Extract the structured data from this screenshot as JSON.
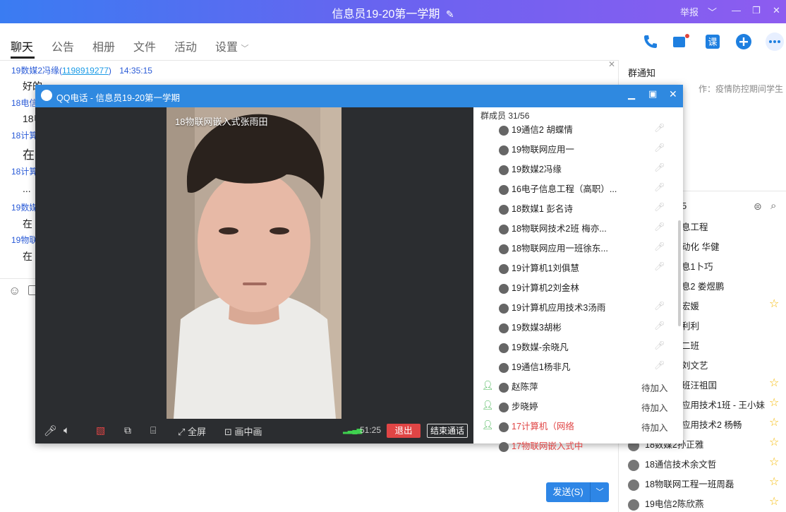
{
  "window": {
    "title": "信息员19-20第一学期",
    "report_label": "举报"
  },
  "tabs": [
    "聊天",
    "公告",
    "相册",
    "文件",
    "活动",
    "设置"
  ],
  "chat": {
    "header1": {
      "user": "19数媒2冯缘(",
      "qq": "1198919277",
      "suffix": ")",
      "time": "14:35:15"
    },
    "body1": "好的",
    "header2": "18电信",
    "body2": "18电",
    "header3": "18计算",
    "body3": "在",
    "header4": "18计算",
    "body4": "...",
    "header5": "19数媒",
    "body5": "在",
    "header6": "19物联",
    "body6": "在"
  },
  "right_panel": {
    "notice_title": "群通知",
    "notice_text": "作：疫情防控期间学生 2...",
    "member_count_partial": "5",
    "members": [
      {
        "name": "息工程",
        "star": false
      },
      {
        "name": "动化  华健",
        "star": false
      },
      {
        "name": "息1卜巧",
        "star": false
      },
      {
        "name": "息2  娄煜鹏",
        "star": false
      },
      {
        "name": "宏媛",
        "star": true
      },
      {
        "name": "利利",
        "star": false
      },
      {
        "name": "二班",
        "star": false
      },
      {
        "name": "刘文艺",
        "star": false
      },
      {
        "name": "班汪祖囯",
        "star": true
      },
      {
        "name": "应用技术1班 - 王小妹",
        "star": true
      },
      {
        "name": "应用技术2  杨畅",
        "star": true
      },
      {
        "name": "18数媒2孙正雅",
        "star": true
      },
      {
        "name": "18通信技术余文哲",
        "star": true
      },
      {
        "name": "18物联网工程一班周磊",
        "star": true
      },
      {
        "name": "19电信2陈欣燕",
        "star": true
      }
    ]
  },
  "call": {
    "title": "QQ电话  -  信息员19-20第一学期",
    "video_caption": "18物联网嵌入式张雨田",
    "members_label": "群成员 31/56",
    "members": [
      {
        "name": "19通信2 胡蝶情",
        "status": "muted"
      },
      {
        "name": "19物联网应用一",
        "status": "muted"
      },
      {
        "name": "19数媒2冯缘",
        "status": "muted"
      },
      {
        "name": "16电子信息工程（高职）...",
        "status": "muted"
      },
      {
        "name": "18数媒1 彭名诗",
        "status": "muted"
      },
      {
        "name": "18物联网技术2班  梅亦...",
        "status": "muted"
      },
      {
        "name": "18物联网应用一班徐东...",
        "status": "muted"
      },
      {
        "name": "19计算机1刘俱慧",
        "status": "muted"
      },
      {
        "name": "19计算机2刘金林",
        "status": "none"
      },
      {
        "name": "19计算机应用技术3汤雨",
        "status": "muted"
      },
      {
        "name": "19数媒3胡彬",
        "status": "muted"
      },
      {
        "name": "19数媒-余晓凡",
        "status": "muted"
      },
      {
        "name": "19通信1杨非凡",
        "status": "muted"
      },
      {
        "name": "赵陈萍",
        "status": "waiting"
      },
      {
        "name": "步晓婷",
        "status": "waiting"
      },
      {
        "name": "17计算机（网络",
        "status": "waiting",
        "red": true
      },
      {
        "name": "17物联网嵌入式中",
        "status": "none",
        "red": true
      }
    ],
    "waiting_label": "待加入",
    "controls": {
      "fullscreen": "全屏",
      "pip": "画中画",
      "time": "51:25",
      "exit": "退出",
      "end": "结束通话"
    }
  },
  "send": {
    "label": "发送(S)"
  },
  "colors": {
    "accent": "#2f89e0",
    "danger": "#e04545",
    "star": "#f5b800"
  }
}
